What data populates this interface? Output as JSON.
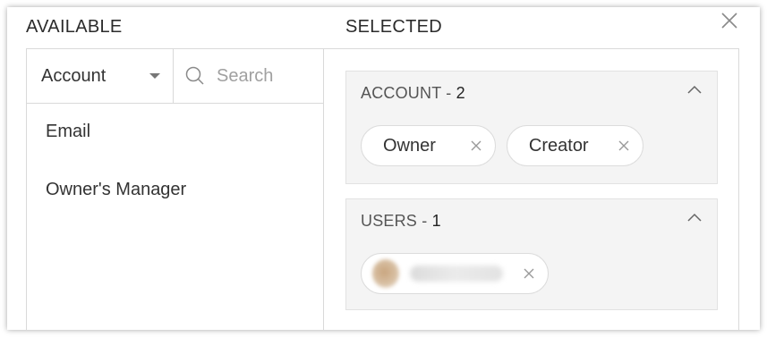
{
  "headers": {
    "available": "AVAILABLE",
    "selected": "SELECTED"
  },
  "filter": {
    "dropdown_value": "Account",
    "search_placeholder": "Search"
  },
  "available_items": [
    {
      "label": "Email"
    },
    {
      "label": "Owner's Manager"
    }
  ],
  "groups": {
    "account": {
      "label": "ACCOUNT - ",
      "count": "2",
      "chips": [
        "Owner",
        "Creator"
      ]
    },
    "users": {
      "label": "USERS - ",
      "count": "1"
    }
  },
  "icons": {
    "close": "close-icon",
    "search": "search-icon",
    "dropdown": "caret-down-icon",
    "collapse": "chevron-up-icon",
    "remove": "close-small-icon"
  }
}
